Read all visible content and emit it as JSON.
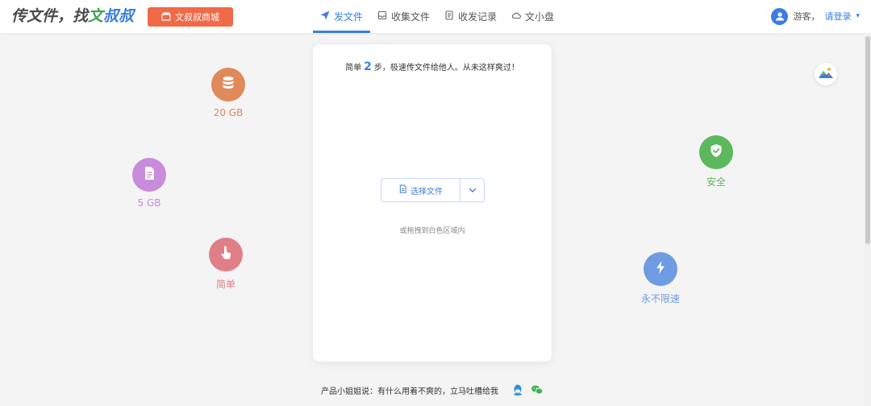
{
  "header": {
    "brand": {
      "part1": "传文件，找",
      "part2": "文",
      "part3": "叔叔"
    },
    "store_button": "文叔叔商城",
    "nav": [
      {
        "label": "发文件",
        "icon": "paper-plane-icon",
        "active": true
      },
      {
        "label": "收集文件",
        "icon": "inbox-icon",
        "active": false
      },
      {
        "label": "收发记录",
        "icon": "record-icon",
        "active": false
      },
      {
        "label": "文小盘",
        "icon": "cloud-disk-icon",
        "active": false
      }
    ],
    "user": {
      "guest": "游客，",
      "login": "请登录",
      "caret": "▾"
    }
  },
  "card": {
    "tagline_before": "简单",
    "tagline_number": "2",
    "tagline_after": "步，极速传文件给他人。从未这样爽过！",
    "select_label": "选择文件",
    "drop_hint": "或拖拽到白色区域内"
  },
  "features": {
    "storage": {
      "label": "20 GB",
      "color": "#e0895a",
      "icon": "database-icon"
    },
    "doc": {
      "label": "5 GB",
      "color": "#c98bdc",
      "icon": "document-icon"
    },
    "easy": {
      "label": "简单",
      "color": "#e07f88",
      "icon": "tap-hand-icon"
    },
    "safe": {
      "label": "安全",
      "color": "#5cb85c",
      "icon": "shield-check-icon"
    },
    "speed": {
      "label": "永不限速",
      "color": "#6f9be3",
      "icon": "lightning-icon"
    }
  },
  "footer": {
    "text": "产品小姐姐说：有什么用着不爽的，立马吐槽给我",
    "qq_icon": "qq-icon",
    "wechat_icon": "wechat-icon"
  },
  "colors": {
    "accent": "#3b7de0",
    "store": "#f06a47",
    "brand_green": "#3fa34d"
  }
}
